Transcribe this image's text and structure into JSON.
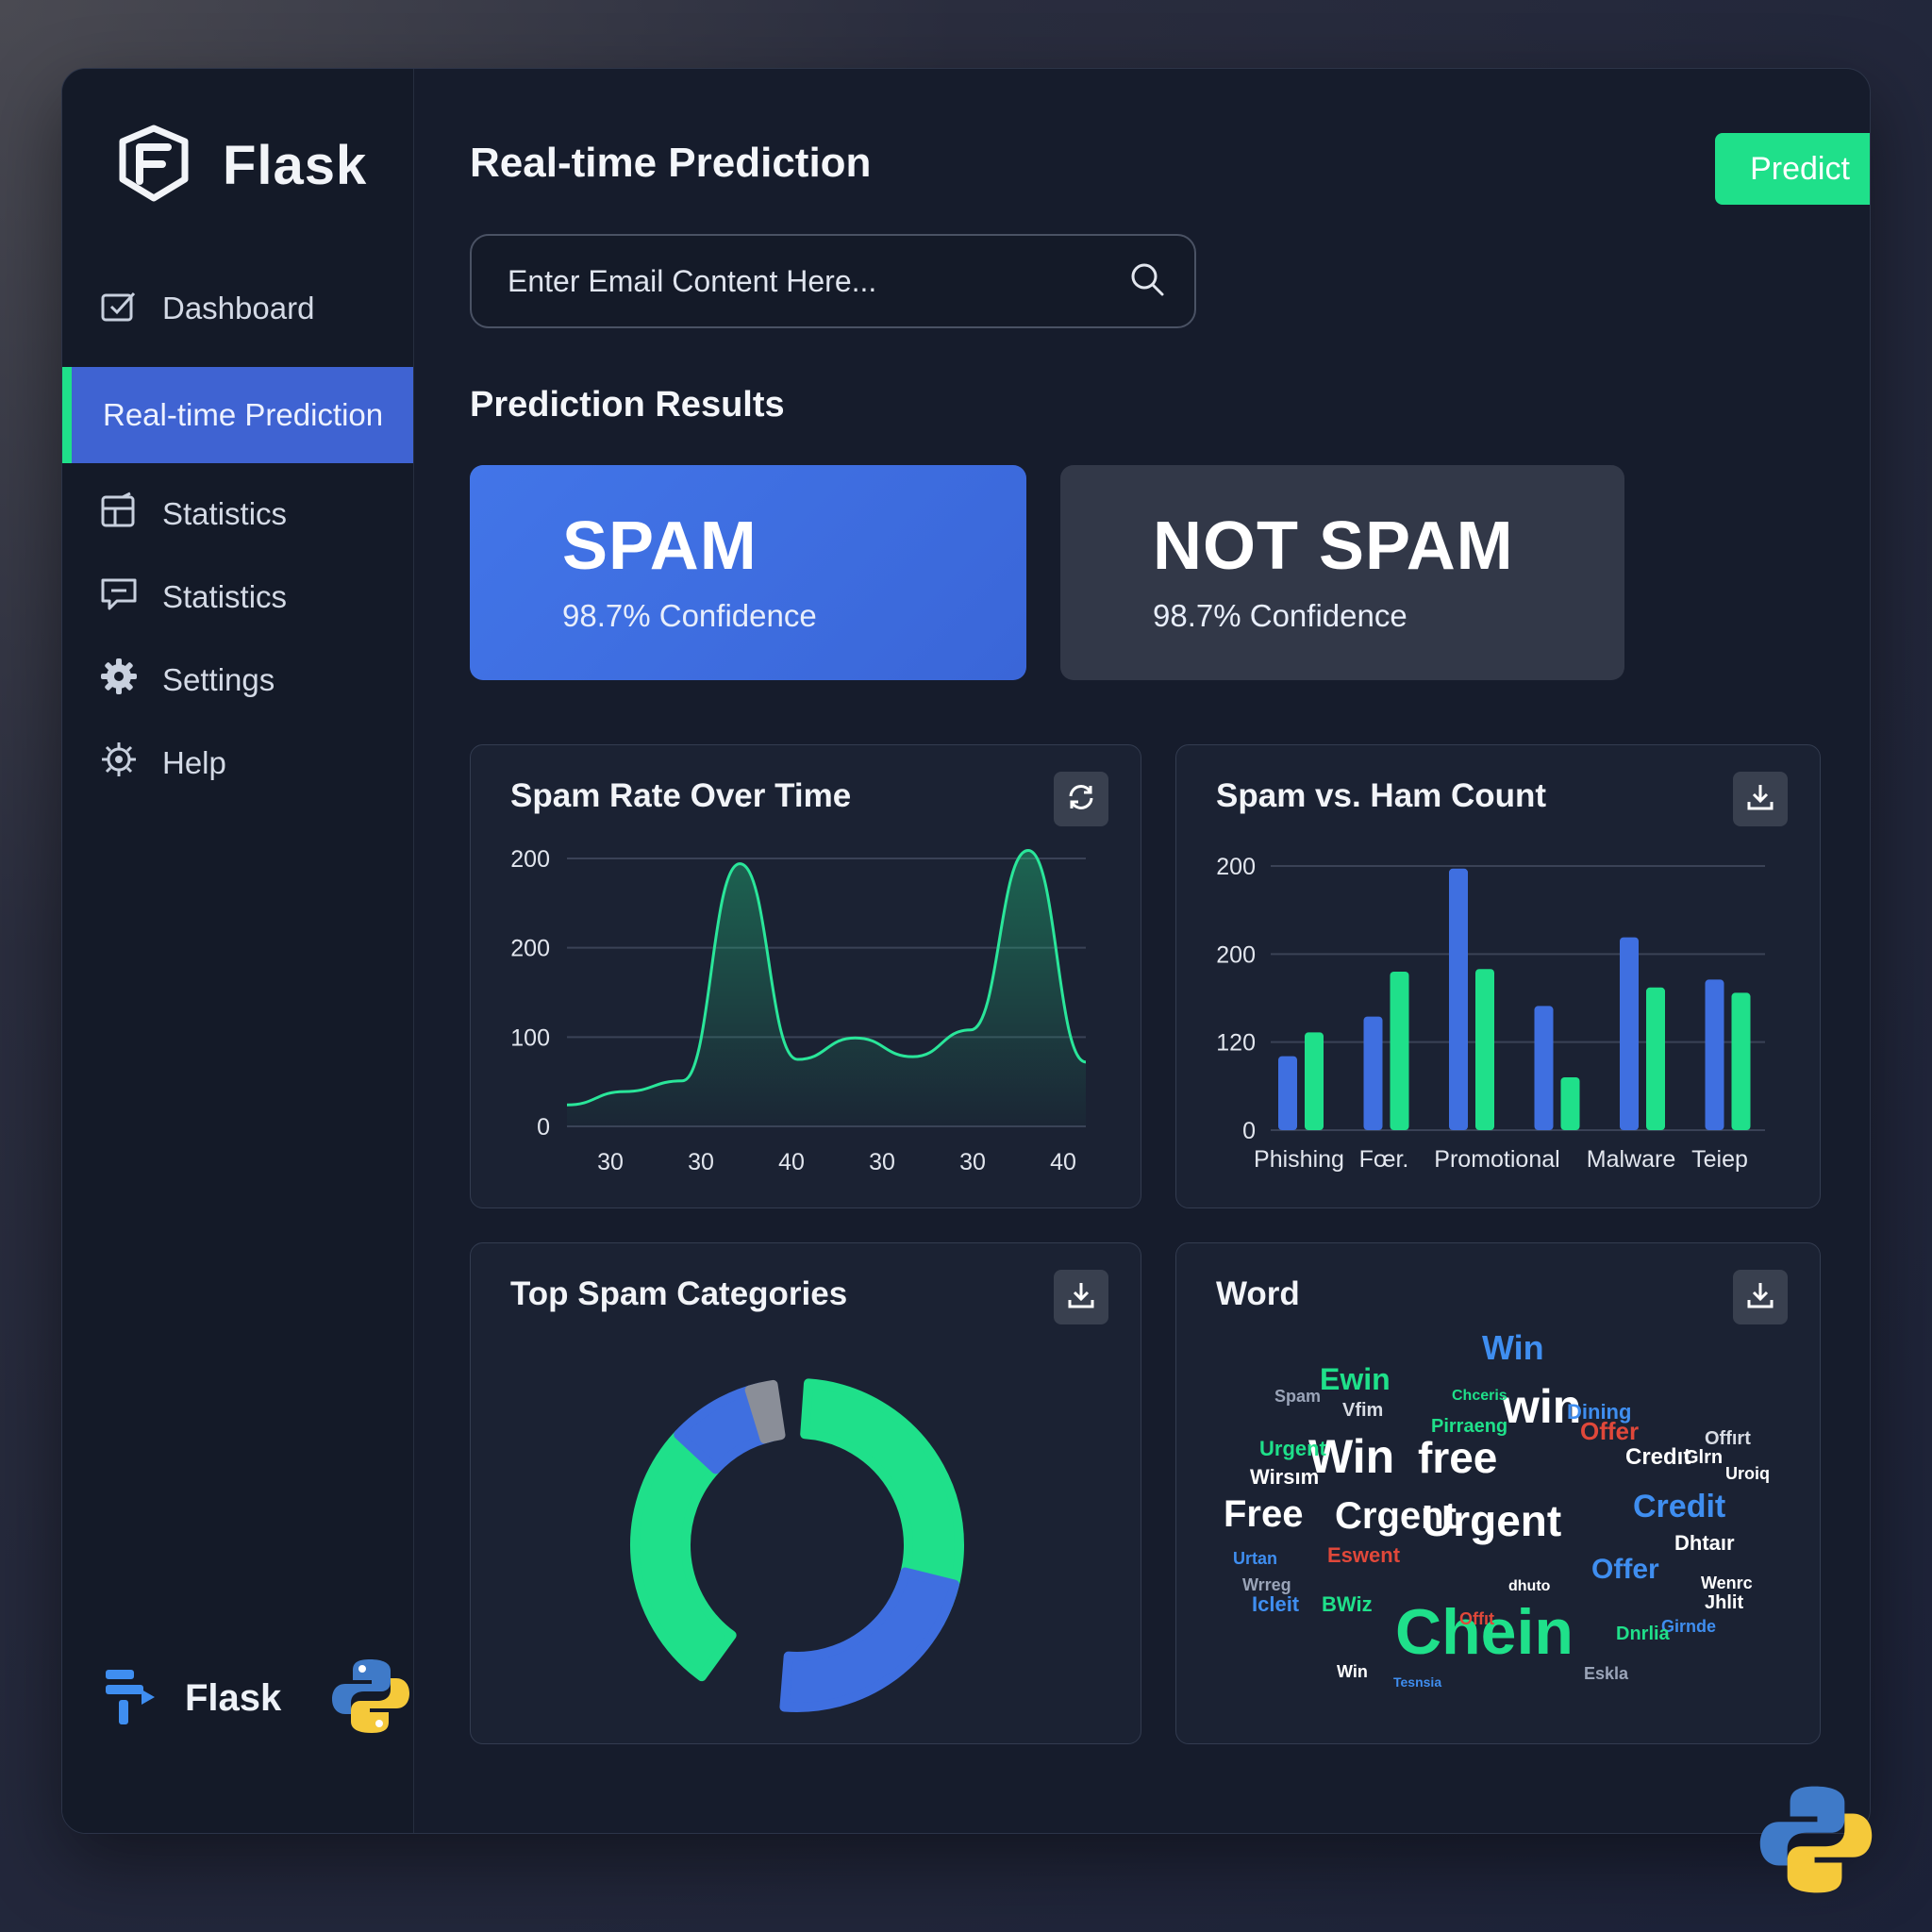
{
  "sidebar": {
    "brand": "Flask",
    "items": [
      {
        "label": "Dashboard",
        "icon": "dashboard-icon"
      },
      {
        "label": "Real-time Prediction",
        "icon": "",
        "active": true
      },
      {
        "label": "Statistics",
        "icon": "statistics-icon"
      },
      {
        "label": "Statistics",
        "icon": "chat-icon"
      },
      {
        "label": "Settings",
        "icon": "gear-icon"
      },
      {
        "label": "Help",
        "icon": "gear-icon"
      }
    ],
    "footer_brand": "Flask"
  },
  "header": {
    "title": "Real-time Prediction",
    "predict_label": "Predict"
  },
  "search": {
    "placeholder": "Enter Email Content Here..."
  },
  "results": {
    "section_title": "Prediction Results",
    "spam": {
      "label": "SPAM",
      "confidence": "98.7% Confidence"
    },
    "not_spam": {
      "label": "NOT SPAM",
      "confidence": "98.7% Confidence"
    }
  },
  "colors": {
    "accent_green": "#1fe08a",
    "accent_blue": "#3f6fe0",
    "panel": "#1b2233"
  },
  "cards": {
    "rate": {
      "title": "Spam Rate Over Time",
      "button_icon": "refresh-icon"
    },
    "count": {
      "title": "Spam vs. Ham Count",
      "button_icon": "download-icon"
    },
    "categories": {
      "title": "Top Spam Categories",
      "button_icon": "download-icon"
    },
    "word": {
      "title": "Word",
      "button_icon": "download-icon"
    }
  },
  "chart_data": [
    {
      "type": "line",
      "title": "Spam Rate Over Time",
      "x_ticks": [
        "30",
        "30",
        "40",
        "30",
        "30",
        "40"
      ],
      "y_ticks": [
        "0",
        "100",
        "200",
        "200"
      ],
      "series": [
        {
          "values": [
            0.08,
            0.13,
            0.17,
            0.98,
            0.25,
            0.33,
            0.26,
            0.36,
            1.03,
            0.24
          ]
        }
      ],
      "grid": true
    },
    {
      "type": "bar",
      "title": "Spam vs. Ham Count",
      "categories": [
        "Phishing",
        "Fœr.",
        "Promotional",
        "Malware",
        "Teiep"
      ],
      "y_ticks": [
        "0",
        "120",
        "200",
        "200"
      ],
      "series": [
        {
          "values": [
            28,
            43,
            99,
            47,
            73,
            57
          ]
        },
        {
          "values": [
            37,
            60,
            61,
            20,
            54,
            52
          ]
        }
      ],
      "grid": true
    },
    {
      "type": "pie",
      "title": "Top Spam Categories",
      "slices": [
        {
          "value": 27,
          "color": "#1fe08a"
        },
        {
          "value": 19,
          "color": "#3f6fe0"
        },
        {
          "value": 23,
          "color": "#1fe08a"
        },
        {
          "value": 8,
          "color": "#3f6fe0"
        },
        {
          "value": 2,
          "color": "#8a8e98"
        }
      ]
    }
  ],
  "word_cloud": [
    {
      "text": "Chein",
      "color": "#1fe08a"
    },
    {
      "text": "Win",
      "color": "#ffffff"
    },
    {
      "text": "free",
      "color": "#ffffff"
    },
    {
      "text": "Urgent",
      "color": "#ffffff"
    },
    {
      "text": "Free",
      "color": "#ffffff"
    },
    {
      "text": "Crgent",
      "color": "#ffffff"
    },
    {
      "text": "win",
      "color": "#ffffff"
    },
    {
      "text": "Win",
      "color": "#3f8ef0"
    },
    {
      "text": "Credit",
      "color": "#3f8ef0"
    },
    {
      "text": "Ewin",
      "color": "#1fe08a"
    },
    {
      "text": "Offer",
      "color": "#3f8ef0"
    },
    {
      "text": "Offer",
      "color": "#e0483a"
    },
    {
      "text": "Credıt",
      "color": "#ffffff"
    },
    {
      "text": "Urgent",
      "color": "#1fe08a"
    },
    {
      "text": "Wirsım",
      "color": "#ffffff"
    },
    {
      "text": "Pirraeng",
      "color": "#1fe08a"
    },
    {
      "text": "Dhtaır",
      "color": "#ffffff"
    },
    {
      "text": "Vfim",
      "color": "#d8dce4"
    },
    {
      "text": "Spam",
      "color": "#9aa4b8"
    },
    {
      "text": "BWiz",
      "color": "#1fe08a"
    },
    {
      "text": "Win",
      "color": "#ffffff"
    },
    {
      "text": "Offırt",
      "color": "#d8dce4"
    },
    {
      "text": "Dining",
      "color": "#3f8ef0"
    },
    {
      "text": "Glrn",
      "color": "#ffffff"
    },
    {
      "text": "Icleit",
      "color": "#3f8ef0"
    },
    {
      "text": "Urtan",
      "color": "#3f8ef0"
    },
    {
      "text": "Uroiq",
      "color": "#ffffff"
    },
    {
      "text": "Wrreg",
      "color": "#9aa4b8"
    },
    {
      "text": "Eswent",
      "color": "#e0483a"
    },
    {
      "text": "Girnde",
      "color": "#3f8ef0"
    },
    {
      "text": "Chceris",
      "color": "#1fe08a"
    },
    {
      "text": "Jhlit",
      "color": "#ffffff"
    },
    {
      "text": "Wenrc",
      "color": "#ffffff"
    },
    {
      "text": "Offıt",
      "color": "#e0483a"
    },
    {
      "text": "Dnrlia",
      "color": "#1fe08a"
    },
    {
      "text": "dhuto",
      "color": "#ffffff"
    },
    {
      "text": "Eskla",
      "color": "#9aa4b8"
    },
    {
      "text": "Tesnsia",
      "color": "#3f8ef0"
    }
  ]
}
